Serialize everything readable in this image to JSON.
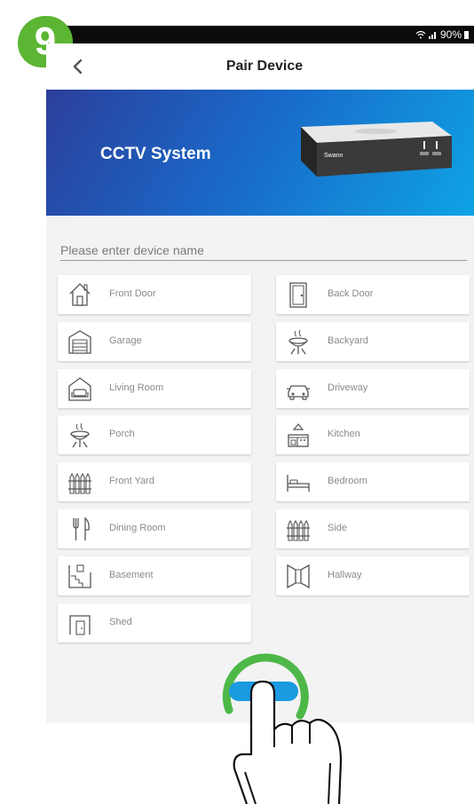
{
  "step": "9",
  "status": {
    "battery": "90%"
  },
  "header": {
    "title": "Pair Device"
  },
  "banner": {
    "title": "CCTV System",
    "brand": "Swann"
  },
  "device_name": {
    "placeholder": "Please enter device name",
    "value": ""
  },
  "rooms_left": [
    {
      "label": "Front Door",
      "icon": "house-icon"
    },
    {
      "label": "Garage",
      "icon": "garage-icon"
    },
    {
      "label": "Living Room",
      "icon": "living-room-icon"
    },
    {
      "label": "Porch",
      "icon": "bbq-icon"
    },
    {
      "label": "Front Yard",
      "icon": "fence-icon"
    },
    {
      "label": "Dining Room",
      "icon": "cutlery-icon"
    },
    {
      "label": "Basement",
      "icon": "basement-icon"
    },
    {
      "label": "Shed",
      "icon": "shed-icon"
    }
  ],
  "rooms_right": [
    {
      "label": "Back Door",
      "icon": "door-icon"
    },
    {
      "label": "Backyard",
      "icon": "bbq-icon"
    },
    {
      "label": "Driveway",
      "icon": "car-icon"
    },
    {
      "label": "Kitchen",
      "icon": "kitchen-icon"
    },
    {
      "label": "Bedroom",
      "icon": "bed-icon"
    },
    {
      "label": "Side",
      "icon": "fence-icon"
    },
    {
      "label": "Hallway",
      "icon": "hallway-icon"
    }
  ],
  "colors": {
    "accent": "#1a9ae0",
    "badge": "#5cb533",
    "tap_ring": "#4db848"
  }
}
